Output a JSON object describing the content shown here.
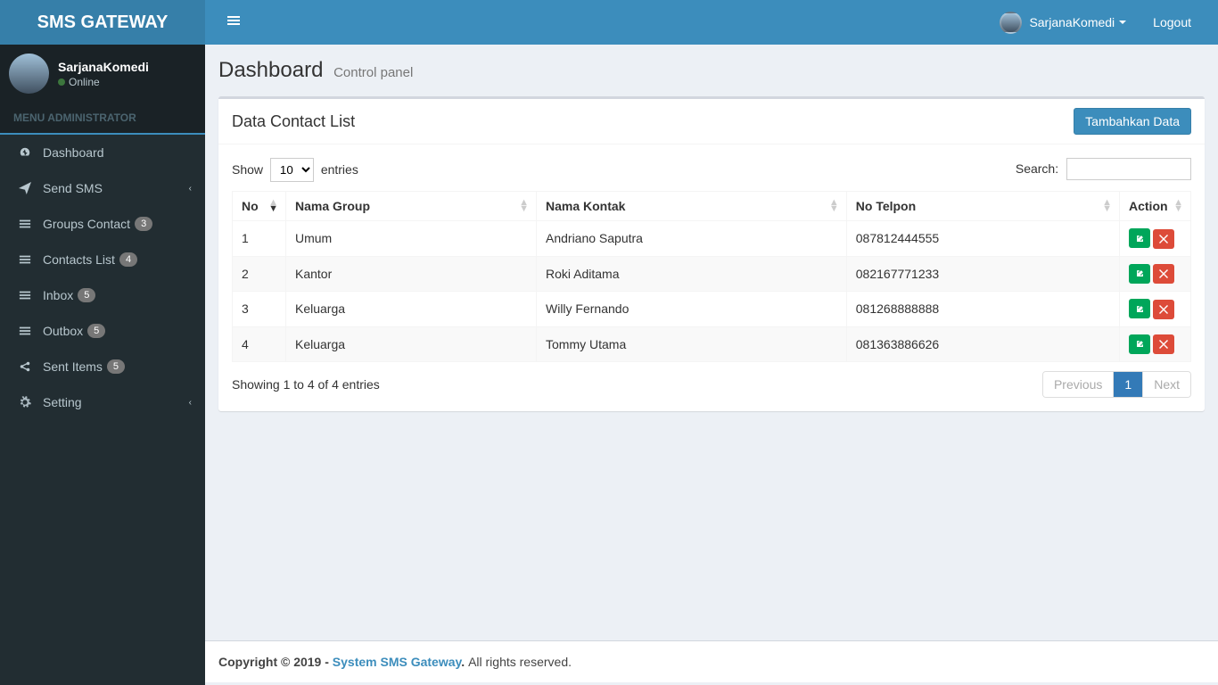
{
  "brand": "SMS GATEWAY",
  "header": {
    "username": "SarjanaKomedi",
    "logout": "Logout"
  },
  "user_panel": {
    "name": "SarjanaKomedi",
    "status": "Online"
  },
  "sidebar": {
    "header": "MENU ADMINISTRATOR",
    "items": [
      {
        "label": "Dashboard",
        "badge": null,
        "arrow": false
      },
      {
        "label": "Send SMS",
        "badge": null,
        "arrow": true
      },
      {
        "label": "Groups Contact",
        "badge": "3",
        "arrow": false
      },
      {
        "label": "Contacts List",
        "badge": "4",
        "arrow": false
      },
      {
        "label": "Inbox",
        "badge": "5",
        "arrow": false
      },
      {
        "label": "Outbox",
        "badge": "5",
        "arrow": false
      },
      {
        "label": "Sent Items",
        "badge": "5",
        "arrow": false
      },
      {
        "label": "Setting",
        "badge": null,
        "arrow": true
      }
    ]
  },
  "page": {
    "title": "Dashboard",
    "subtitle": "Control panel",
    "box_title": "Data Contact List",
    "add_button": "Tambahkan Data"
  },
  "datatable": {
    "show_prefix": "Show",
    "show_suffix": "entries",
    "length_value": "10",
    "search_label": "Search:",
    "columns": [
      "No",
      "Nama Group",
      "Nama Kontak",
      "No Telpon",
      "Action"
    ],
    "rows": [
      {
        "no": "1",
        "group": "Umum",
        "kontak": "Andriano Saputra",
        "telpon": "087812444555"
      },
      {
        "no": "2",
        "group": "Kantor",
        "kontak": "Roki Aditama",
        "telpon": "082167771233"
      },
      {
        "no": "3",
        "group": "Keluarga",
        "kontak": "Willy Fernando",
        "telpon": "081268888888"
      },
      {
        "no": "4",
        "group": "Keluarga",
        "kontak": "Tommy Utama",
        "telpon": "081363886626"
      }
    ],
    "info": "Showing 1 to 4 of 4 entries",
    "prev": "Previous",
    "page": "1",
    "next": "Next"
  },
  "footer": {
    "copyright_strong": "Copyright © 2019 - ",
    "link": "System SMS Gateway",
    "rights": " All rights reserved."
  }
}
